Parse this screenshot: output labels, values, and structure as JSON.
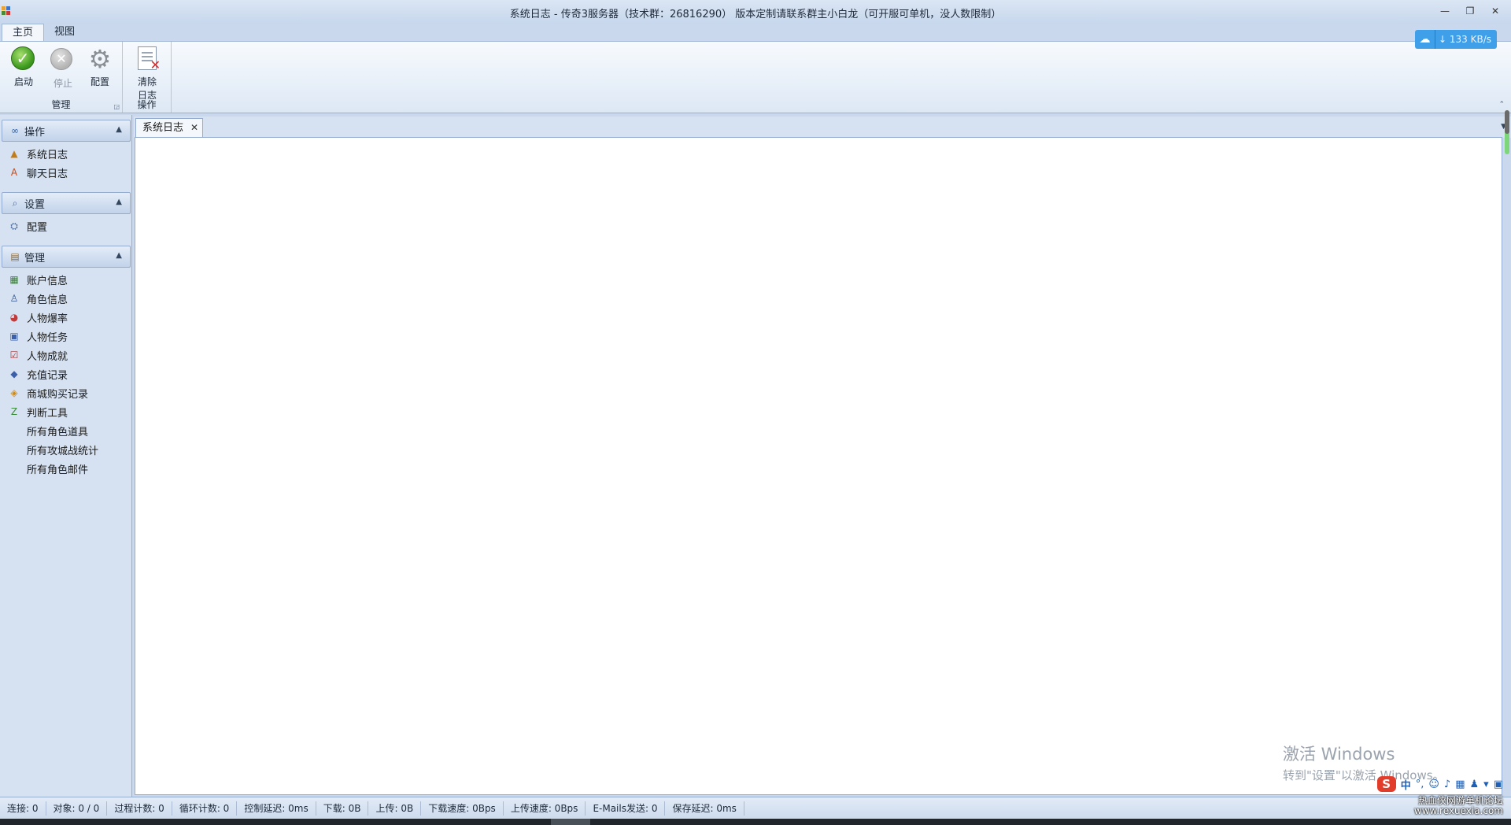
{
  "window": {
    "title": "系统日志 - 传奇3服务器（技术群：26816290） 版本定制请联系群主小白龙（可开服可单机，没人数限制）",
    "minimize": "—",
    "restore": "❐",
    "close": "✕"
  },
  "ribbon_tabs": [
    {
      "label": "主页",
      "active": true
    },
    {
      "label": "视图",
      "active": false
    }
  ],
  "ribbon": {
    "groups": [
      {
        "label": "管理",
        "buttons": [
          {
            "label": "启动",
            "icon": "start-icon",
            "enabled": true
          },
          {
            "label": "停止",
            "icon": "stop-icon",
            "enabled": false
          },
          {
            "label": "配置",
            "icon": "gear-icon",
            "enabled": true
          }
        ]
      },
      {
        "label": "操作",
        "buttons": [
          {
            "label_line1": "清除",
            "label_line2": "日志",
            "icon": "clear-log-icon",
            "enabled": true
          }
        ]
      }
    ],
    "speed_badge": "133 KB/s"
  },
  "nav": {
    "groups": [
      {
        "label": "操作",
        "icon": "binoculars-icon",
        "items": [
          {
            "label": "系统日志",
            "icon": "system-log-icon"
          },
          {
            "label": "聊天日志",
            "icon": "chat-log-icon"
          }
        ]
      },
      {
        "label": "设置",
        "icon": "settings-icon",
        "items": [
          {
            "label": "配置",
            "icon": "config-icon"
          }
        ]
      },
      {
        "label": "管理",
        "icon": "manage-icon",
        "items": [
          {
            "label": "账户信息",
            "icon": "account-icon"
          },
          {
            "label": "角色信息",
            "icon": "character-icon"
          },
          {
            "label": "人物爆率",
            "icon": "drop-rate-icon"
          },
          {
            "label": "人物任务",
            "icon": "quest-icon"
          },
          {
            "label": "人物成就",
            "icon": "achievement-icon"
          },
          {
            "label": "充值记录",
            "icon": "recharge-icon"
          },
          {
            "label": "商城购买记录",
            "icon": "shop-icon"
          },
          {
            "label": "判断工具",
            "icon": "tool-icon"
          },
          {
            "label": "所有角色道具",
            "icon": ""
          },
          {
            "label": "所有攻城战统计",
            "icon": ""
          },
          {
            "label": "所有角色邮件",
            "icon": ""
          }
        ]
      }
    ]
  },
  "document": {
    "tab_label": "系统日志",
    "tab_close": "✕"
  },
  "activation": {
    "line1": "激活 Windows",
    "line2": "转到\"设置\"以激活 Windows。"
  },
  "statusbar": [
    "连接: 0",
    "对象: 0 / 0",
    "过程计数: 0",
    "循环计数: 0",
    "控制延迟: 0ms",
    "下载: 0B",
    "上传: 0B",
    "下载速度: 0Bps",
    "上传速度: 0Bps",
    "E-Mails发送: 0",
    "保存延迟: 0ms"
  ],
  "ime": {
    "logo": "S",
    "mode": "中"
  },
  "watermark": {
    "line1": "热血侠网游单机论坛",
    "line2": "www.rexuexia.com"
  }
}
